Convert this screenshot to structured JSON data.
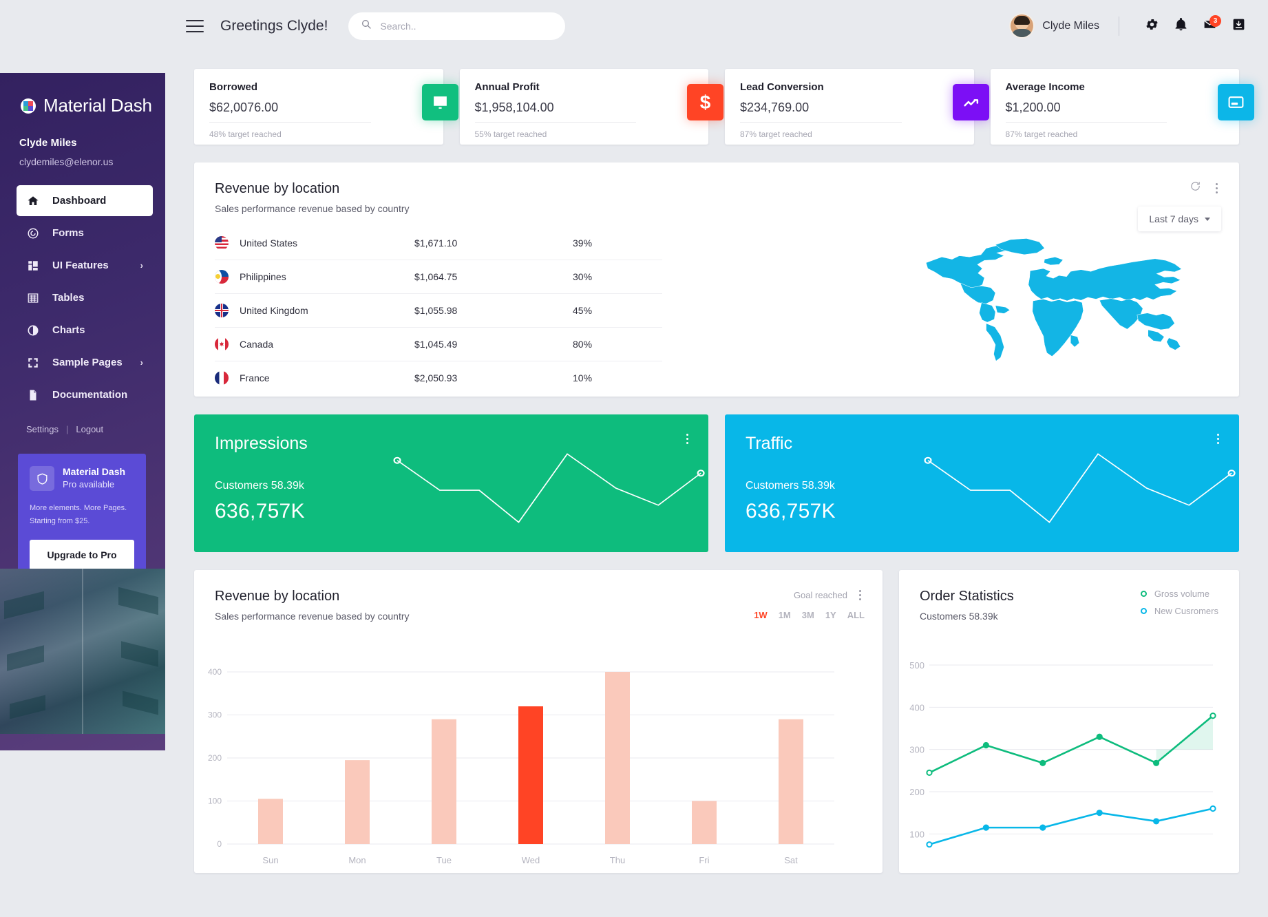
{
  "brand": {
    "name": "Material Dash"
  },
  "topbar": {
    "greeting": "Greetings Clyde!",
    "search_placeholder": "Search..",
    "search_value": "",
    "account_name": "Clyde Miles",
    "mail_badge": "3"
  },
  "sidebar": {
    "user_name": "Clyde Miles",
    "user_email": "clydemiles@elenor.us",
    "items": [
      {
        "label": "Dashboard",
        "icon": "home-icon",
        "active": true,
        "caret": ""
      },
      {
        "label": "Forms",
        "icon": "forms-icon",
        "active": false,
        "caret": ""
      },
      {
        "label": "UI Features",
        "icon": "grid-icon",
        "active": false,
        "caret": "›"
      },
      {
        "label": "Tables",
        "icon": "table-icon",
        "active": false,
        "caret": ""
      },
      {
        "label": "Charts",
        "icon": "pie-chart-icon",
        "active": false,
        "caret": ""
      },
      {
        "label": "Sample Pages",
        "icon": "expand-icon",
        "active": false,
        "caret": "›"
      },
      {
        "label": "Documentation",
        "icon": "document-icon",
        "active": false,
        "caret": ""
      }
    ],
    "footer": {
      "settings": "Settings",
      "separator": "|",
      "logout": "Logout"
    },
    "promo": {
      "title": "Material Dash",
      "subtitle": "Pro available",
      "line1": "More elements. More Pages.",
      "line2": "Starting from $25.",
      "button": "Upgrade to Pro"
    }
  },
  "stats": [
    {
      "title": "Borrowed",
      "value": "$62,0076.00",
      "note": "48% target reached",
      "icon": "receipt-icon",
      "color": "#11bf7f"
    },
    {
      "title": "Annual Profit",
      "value": "$1,958,104.00",
      "note": "55% target reached",
      "icon": "dollar-icon",
      "color": "#ff4425"
    },
    {
      "title": "Lead Conversion",
      "value": "$234,769.00",
      "note": "87% target reached",
      "icon": "trending-icon",
      "color": "#7c0ff5"
    },
    {
      "title": "Average Income",
      "value": "$1,200.00",
      "note": "87% target reached",
      "icon": "card-icon",
      "color": "#0cb6e8"
    }
  ],
  "revenue_panel": {
    "title": "Revenue by location",
    "subtitle": "Sales performance revenue based by country",
    "range_label": "Last 7 days",
    "refresh_icon": "refresh-icon",
    "menu_icon": "kebab-menu-icon",
    "map_color": "#13b5e5",
    "rows": [
      {
        "country": "United States",
        "amount": "$1,671.10",
        "percent": "39%"
      },
      {
        "country": "Philippines",
        "amount": "$1,064.75",
        "percent": "30%"
      },
      {
        "country": "United Kingdom",
        "amount": "$1,055.98",
        "percent": "45%"
      },
      {
        "country": "Canada",
        "amount": "$1,045.49",
        "percent": "80%"
      },
      {
        "country": "France",
        "amount": "$2,050.93",
        "percent": "10%"
      }
    ]
  },
  "metrics": [
    {
      "title": "Impressions",
      "sub": "Customers 58.39k",
      "value": "636,757K",
      "color": "#0ebc7d"
    },
    {
      "title": "Traffic",
      "sub": "Customers 58.39k",
      "value": "636,757K",
      "color": "#08b7e8"
    }
  ],
  "bar_panel": {
    "title": "Revenue by location",
    "subtitle": "Sales performance revenue based by country",
    "goal_text": "Goal reached",
    "menu_icon": "kebab-menu-icon",
    "ranges": [
      "1W",
      "1M",
      "3M",
      "1Y",
      "ALL"
    ],
    "active_range": "1W"
  },
  "order_panel": {
    "title": "Order Statistics",
    "subtitle": "Customers 58.39k",
    "legend": [
      {
        "label": "Gross volume",
        "color": "#0ebc7d"
      },
      {
        "label": "New Cusromers",
        "color": "#08b7e8"
      }
    ]
  },
  "chart_data": [
    {
      "type": "bar",
      "title": "Revenue by location",
      "subtitle": "Sales performance revenue based by country",
      "categories": [
        "Sun",
        "Mon",
        "Tue",
        "Wed",
        "Thu",
        "Fri",
        "Sat"
      ],
      "values": [
        105,
        195,
        290,
        320,
        400,
        100,
        290
      ],
      "highlight_index": 3,
      "bar_color": "#fac9bb",
      "highlight_color": "#ff4425",
      "xlabel": "",
      "ylabel": "",
      "ylim": [
        0,
        400
      ],
      "yticks": [
        0,
        100,
        200,
        300,
        400
      ],
      "grid": true,
      "legend": "none"
    },
    {
      "type": "line",
      "title": "Order Statistics",
      "subtitle": "Customers 58.39k",
      "x": [
        1,
        2,
        3,
        4,
        5,
        6
      ],
      "series": [
        {
          "name": "Gross volume",
          "values": [
            245,
            310,
            268,
            330,
            268,
            380
          ],
          "color": "#0ebc7d"
        },
        {
          "name": "New Cusromers",
          "values": [
            75,
            115,
            115,
            150,
            130,
            160
          ],
          "color": "#08b7e8"
        }
      ],
      "ylim": [
        50,
        500
      ],
      "yticks": [
        100,
        200,
        300,
        400,
        500
      ],
      "grid": true,
      "legend": "top-right"
    },
    {
      "type": "line",
      "title": "Impressions",
      "series": [
        {
          "name": "Impressions",
          "values": [
            72,
            45,
            45,
            18,
            62,
            40,
            30,
            52
          ],
          "color": "#ffffff"
        }
      ],
      "ylim": [
        0,
        100
      ],
      "grid": false,
      "legend": "none"
    },
    {
      "type": "line",
      "title": "Traffic",
      "series": [
        {
          "name": "Traffic",
          "values": [
            72,
            45,
            45,
            18,
            62,
            40,
            30,
            52
          ],
          "color": "#ffffff"
        }
      ],
      "ylim": [
        0,
        100
      ],
      "grid": false,
      "legend": "none"
    }
  ]
}
